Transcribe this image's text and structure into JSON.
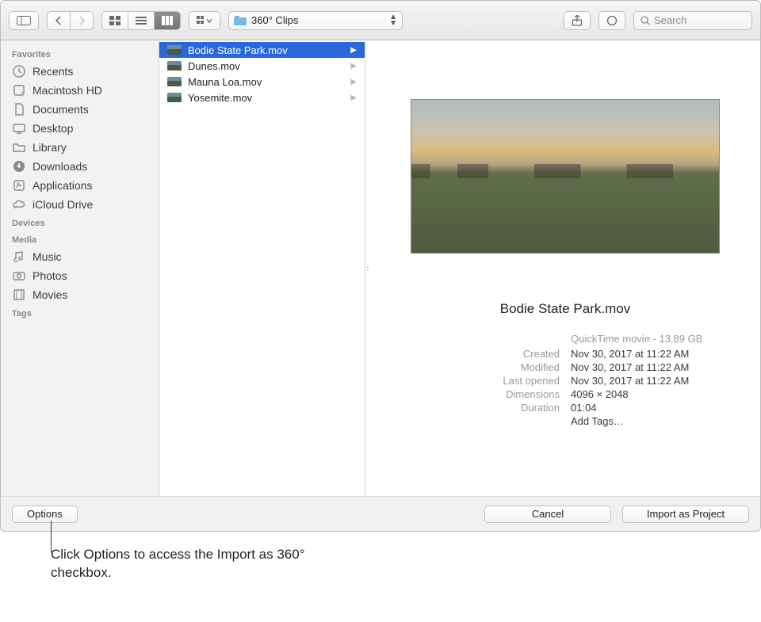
{
  "toolbar": {
    "location_label": "360° Clips",
    "search_placeholder": "Search"
  },
  "sidebar": {
    "sections": [
      {
        "title": "Favorites",
        "items": [
          {
            "label": "Recents",
            "icon": "clock"
          },
          {
            "label": "Macintosh HD",
            "icon": "hdd"
          },
          {
            "label": "Documents",
            "icon": "doc"
          },
          {
            "label": "Desktop",
            "icon": "desktop"
          },
          {
            "label": "Library",
            "icon": "folder"
          },
          {
            "label": "Downloads",
            "icon": "download"
          },
          {
            "label": "Applications",
            "icon": "apps"
          },
          {
            "label": "iCloud Drive",
            "icon": "cloud"
          }
        ]
      },
      {
        "title": "Devices",
        "items": []
      },
      {
        "title": "Media",
        "items": [
          {
            "label": "Music",
            "icon": "music"
          },
          {
            "label": "Photos",
            "icon": "camera"
          },
          {
            "label": "Movies",
            "icon": "film"
          }
        ]
      },
      {
        "title": "Tags",
        "items": []
      }
    ]
  },
  "files": [
    {
      "name": "Bodie State Park.mov",
      "selected": true
    },
    {
      "name": "Dunes.mov",
      "selected": false
    },
    {
      "name": "Mauna Loa.mov",
      "selected": false
    },
    {
      "name": "Yosemite.mov",
      "selected": false
    }
  ],
  "preview": {
    "title": "Bodie State Park.mov",
    "type_size": "QuickTime movie - 13.89 GB",
    "fields": [
      {
        "k": "Created",
        "v": "Nov 30, 2017 at 11:22 AM"
      },
      {
        "k": "Modified",
        "v": "Nov 30, 2017 at 11:22 AM"
      },
      {
        "k": "Last opened",
        "v": "Nov 30, 2017 at 11:22 AM"
      },
      {
        "k": "Dimensions",
        "v": "4096 × 2048"
      },
      {
        "k": "Duration",
        "v": "01:04"
      }
    ],
    "add_tags_label": "Add Tags…"
  },
  "footer": {
    "options_label": "Options",
    "cancel_label": "Cancel",
    "import_label": "Import as Project"
  },
  "callout_text": "Click Options to access the Import as 360° checkbox."
}
